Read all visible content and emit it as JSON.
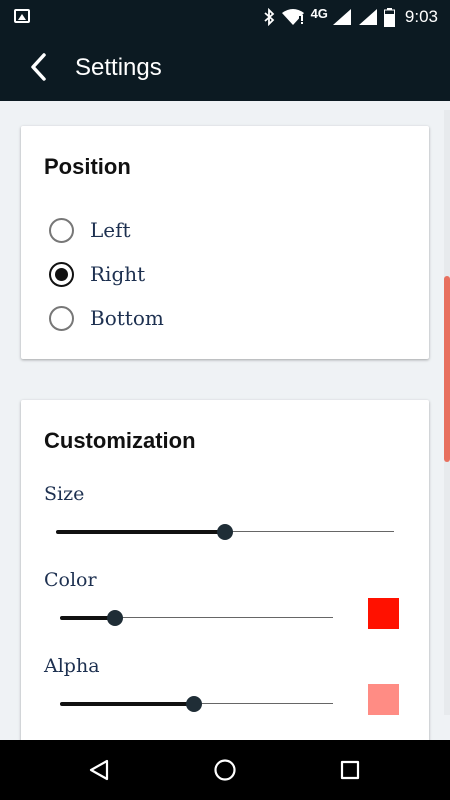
{
  "status_bar": {
    "network": "4G",
    "time": "9:03"
  },
  "app_bar": {
    "title": "Settings"
  },
  "position_card": {
    "title": "Position",
    "options": [
      {
        "label": "Left",
        "checked": false
      },
      {
        "label": "Right",
        "checked": true
      },
      {
        "label": "Bottom",
        "checked": false
      }
    ]
  },
  "customization_card": {
    "title": "Customization",
    "size": {
      "label": "Size",
      "value": 0.5
    },
    "color": {
      "label": "Color",
      "value": 0.2,
      "swatch": "#ff1100"
    },
    "alpha": {
      "label": "Alpha",
      "value": 0.49,
      "swatch": "#ff8c84"
    }
  },
  "colors": {
    "app_bar": "#0c1a22",
    "background": "#eff2f5",
    "scroll_indicator": "#e8705f",
    "label_text": "#1d3050"
  }
}
